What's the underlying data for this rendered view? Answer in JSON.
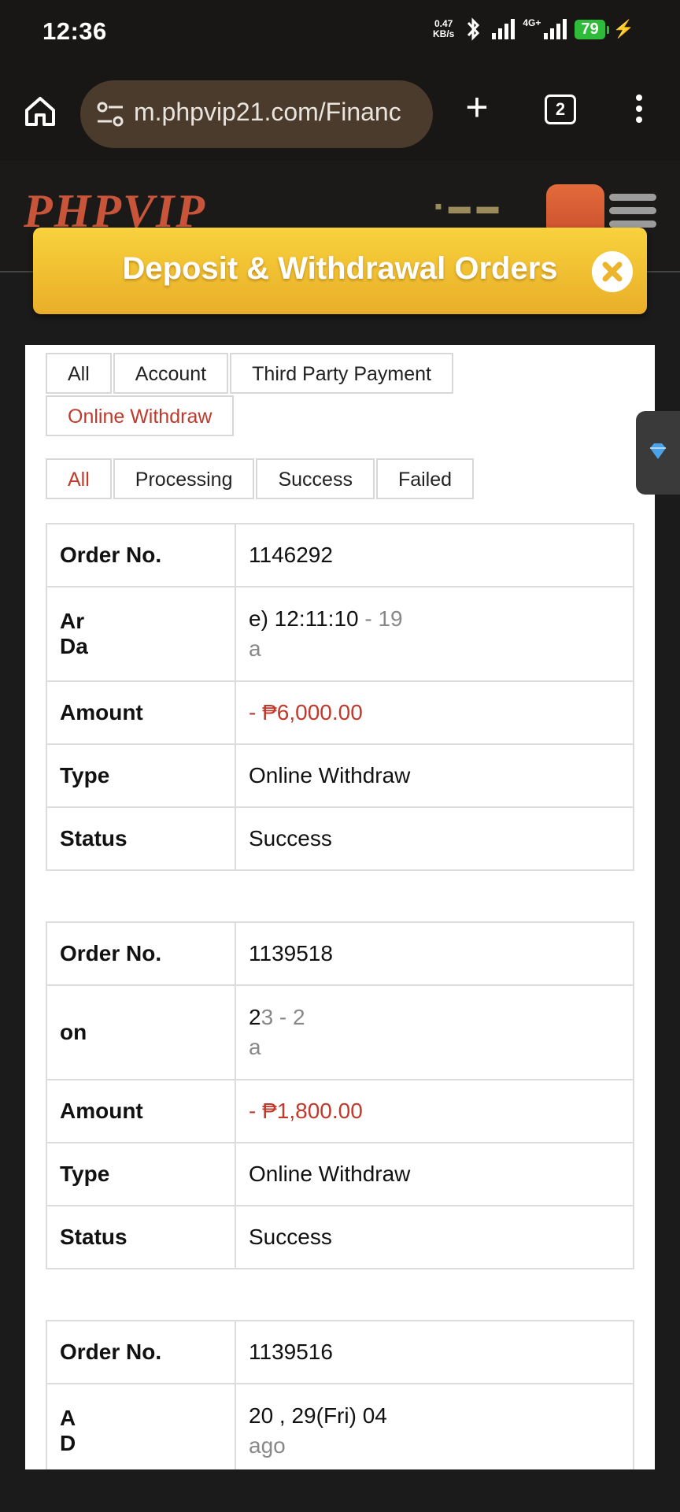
{
  "status_bar": {
    "time": "12:36",
    "net_speed_value": "0.47",
    "net_speed_unit": "KB/s",
    "network_type": "4G+",
    "battery": "79"
  },
  "browser": {
    "url": "m.phpvip21.com/Financ",
    "tab_count": "2"
  },
  "site": {
    "logo": "PHPVIP"
  },
  "modal": {
    "title": "Deposit & Withdrawal Orders"
  },
  "filters": {
    "types": [
      {
        "label": "All",
        "active": false
      },
      {
        "label": "Account",
        "active": false
      },
      {
        "label": "Third Party Payment",
        "active": false
      },
      {
        "label": "Online Withdraw",
        "active": true
      }
    ],
    "statuses": [
      {
        "label": "All",
        "active": true
      },
      {
        "label": "Processing",
        "active": false
      },
      {
        "label": "Success",
        "active": false
      },
      {
        "label": "Failed",
        "active": false
      }
    ]
  },
  "labels": {
    "order_no": "Order No.",
    "application_date": "Ar\nDa",
    "amount": "Amount",
    "type": "Type",
    "status": "Status"
  },
  "orders": [
    {
      "order_no": "1146292",
      "date_line1": "e) 12:11:10",
      "date_suffix": " - 19",
      "date_line2": "a",
      "date_label": "Ar\nDa",
      "amount": "- ₱6,000.00",
      "type": "Online Withdraw",
      "status": "Success"
    },
    {
      "order_no": "1139518",
      "date_line1": "2",
      "date_suffix": "3 - 2",
      "date_line2": "a",
      "date_label": "on",
      "amount": "- ₱1,800.00",
      "type": "Online Withdraw",
      "status": "Success"
    },
    {
      "order_no": "1139516",
      "date_line1": "20 , 29(Fri) 04",
      "date_suffix": "",
      "date_line2": "ago",
      "date_label": "A\nD",
      "amount": "",
      "type": "",
      "status": ""
    }
  ]
}
